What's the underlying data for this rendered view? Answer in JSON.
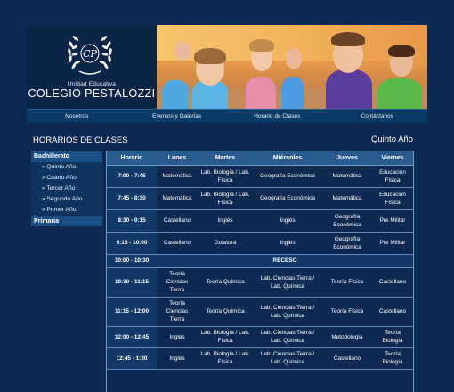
{
  "header": {
    "logo_monogram": "CP",
    "logo_subtitle": "Unidad Educativa",
    "logo_name": "COLEGIO PESTALOZZI"
  },
  "nav": [
    "Nosotros",
    "Eventos y Galerías",
    "Horario de Clases",
    "Contáctanos"
  ],
  "section_title": "HORARIOS DE CLASES",
  "grade": "Quinto Año",
  "sidebar": {
    "group1": "Bachillerato",
    "items": [
      "Quinto Año",
      "Cuarto Año",
      "Tercer Año",
      "Segundo Año",
      "Primer Año"
    ],
    "group2": "Primaria"
  },
  "schedule": {
    "headers": [
      "Horario",
      "Lunes",
      "Martes",
      "Miércoles",
      "Jueves",
      "Viernes"
    ],
    "rows": [
      {
        "time": "7:00 - 7:45",
        "cells": [
          "Matemática",
          "Lab. Biología / Lab. Física",
          "Geografía Económica",
          "Matemática",
          "Educación Física"
        ]
      },
      {
        "time": "7:45 - 8:30",
        "cells": [
          "Matemática",
          "Lab. Biología / Lab. Física",
          "Geografía Económica",
          "Matemática",
          "Educación Física"
        ]
      },
      {
        "time": "8:30 - 9:15",
        "cells": [
          "Castellano",
          "Inglés",
          "Inglés",
          "Geografía Económica",
          "Pre Militar"
        ]
      },
      {
        "time": "9:15 - 10:00",
        "cells": [
          "Castellano",
          "Guiatura",
          "Inglés",
          "Geografía Económica",
          "Pre Militar"
        ]
      },
      {
        "time": "10:00 - 10:30",
        "recess": "RECESO"
      },
      {
        "time": "10:30 - 11:15",
        "cells": [
          "Teoría Ciencias Tierra",
          "Teoría Química",
          "Lab. Ciencias Tierra / Lab. Química",
          "Teoría Física",
          "Castellano"
        ]
      },
      {
        "time": "11:15 - 12:00",
        "cells": [
          "Teoría Ciencias Tierra",
          "Teoría Química",
          "Lab. Ciencias Tierra / Lab. Química",
          "Teoría Física",
          "Castellano"
        ]
      },
      {
        "time": "12:00 - 12:45",
        "cells": [
          "Inglés",
          "Lab. Biología / Lab. Física",
          "Lab. Ciencias Tierra / Lab. Química",
          "Metodología",
          "Teoría Biología"
        ]
      },
      {
        "time": "12:45 - 1:30",
        "cells": [
          "Inglés",
          "Lab. Biología / Lab. Física",
          "Lab. Ciencias Tierra / Lab. Química",
          "Castellano",
          "Teoría Biología"
        ]
      }
    ]
  }
}
